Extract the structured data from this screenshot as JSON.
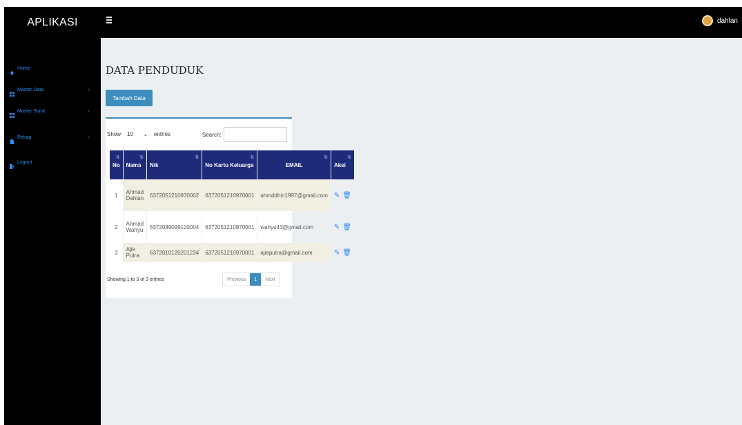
{
  "app": {
    "brand": "APLIKASI",
    "username": "dahlan"
  },
  "sidebar": {
    "items": [
      {
        "label": "Home",
        "icon": "home-icon",
        "color": "#2d8cf0"
      },
      {
        "label": "Master Data",
        "icon": "grid-icon",
        "color": "#2d8cf0"
      },
      {
        "label": "Master Surat",
        "icon": "grid-icon",
        "color": "#2d8cf0"
      },
      {
        "label": "Rekap",
        "icon": "document-icon",
        "color": "#2d8cf0"
      },
      {
        "label": "Logout",
        "icon": "logout-icon",
        "color": "#2d8cf0"
      }
    ]
  },
  "main": {
    "title": "DATA PENDUDUK",
    "add_button": "Tambah Data",
    "length": {
      "show": "Show",
      "value": "10",
      "entries": "entries"
    },
    "search": {
      "label": "Search:",
      "value": ""
    },
    "table": {
      "headers": [
        "No",
        "Nama",
        "Nik",
        "No Kartu Keluarga",
        "EMAIL",
        "Aksi"
      ],
      "rows": [
        {
          "no": "1",
          "nama": "Ahmad Dahlan",
          "nik": "6372051210970002",
          "kk": "6372051210970001",
          "email": "ahmddhin1997@gmail.com"
        },
        {
          "no": "2",
          "nama": "Ahmad Wahyu",
          "nik": "6372089099120004",
          "kk": "6372051210970001",
          "email": "wahyu43@gmail.com"
        },
        {
          "no": "3",
          "nama": "Ajie Putra",
          "nik": "6372010120201234",
          "kk": "6372051210970001",
          "email": "ajieputra@gmail.com"
        }
      ]
    },
    "info": "Showing 1 to 3 of 3 entries",
    "pager": {
      "previous": "Previous",
      "current": "1",
      "next": "Next"
    }
  },
  "colors": {
    "accent": "#3c8dbc",
    "header": "#1e2b7a",
    "link": "#2d8cf0"
  }
}
